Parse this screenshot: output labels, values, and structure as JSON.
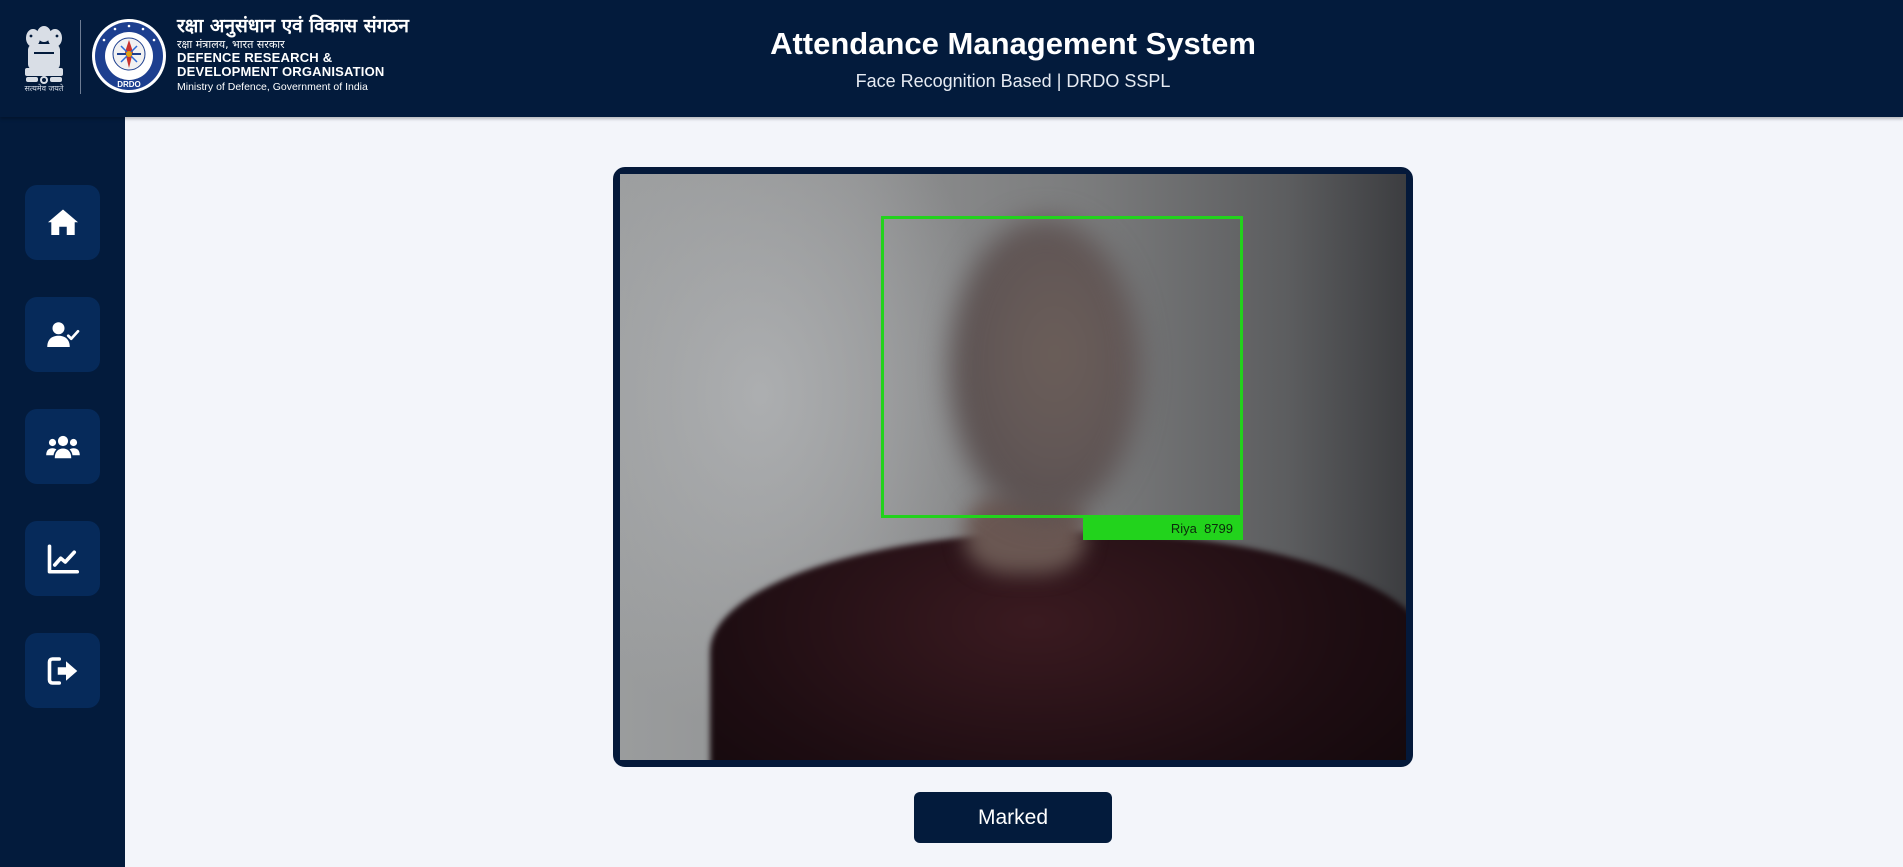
{
  "header": {
    "emblem_caption": "सत्यमेव जयते",
    "org_name_hindi": "रक्षा अनुसंधान एवं विकास संगठन",
    "org_sub_hindi": "रक्षा मंत्रालय, भारत सरकार",
    "org_name_line1": "DEFENCE RESEARCH &",
    "org_name_line2": "DEVELOPMENT ORGANISATION",
    "ministry": "Ministry of Defence, Government of India",
    "logo_text": "DRDO",
    "title": "Attendance Management System",
    "subtitle": "Face Recognition Based | DRDO SSPL"
  },
  "sidebar": {
    "items": [
      {
        "icon": "home-icon"
      },
      {
        "icon": "user-check-icon"
      },
      {
        "icon": "users-icon"
      },
      {
        "icon": "chart-line-icon"
      },
      {
        "icon": "logout-icon"
      }
    ]
  },
  "camera": {
    "detection_label": "Riya  8799",
    "box_color": "#22d31c"
  },
  "status_button": {
    "label": "Marked"
  },
  "colors": {
    "navy": "#031b3c",
    "nav_button": "#062a5a",
    "background": "#f3f5fa",
    "detection_green": "#22d31c"
  }
}
